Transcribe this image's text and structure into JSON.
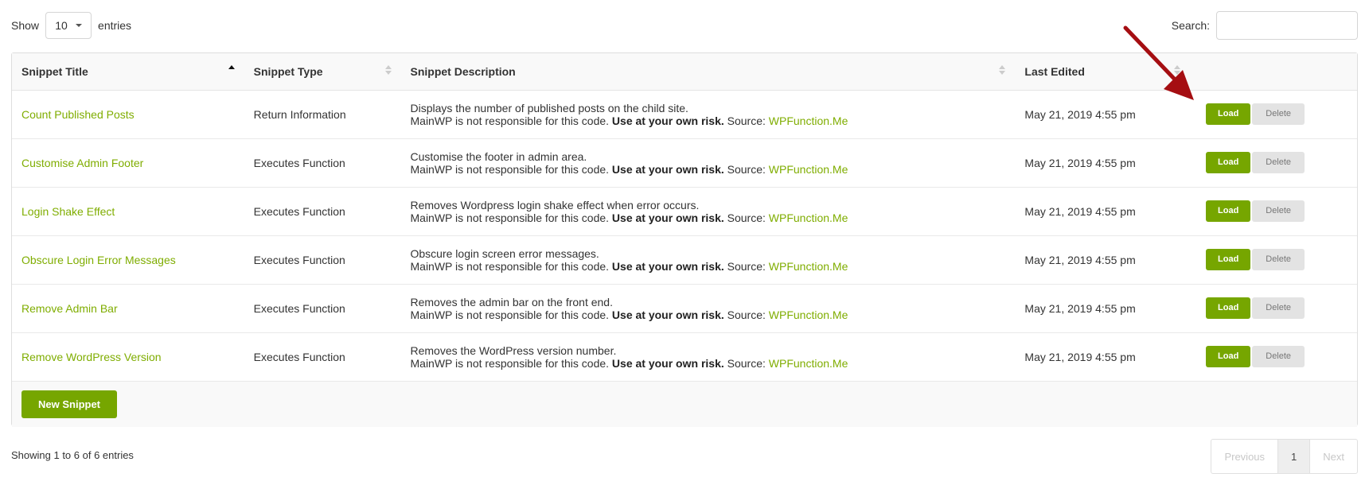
{
  "length": {
    "show_label": "Show",
    "value": "10",
    "entries_label": "entries"
  },
  "search": {
    "label": "Search:",
    "value": "",
    "placeholder": ""
  },
  "table": {
    "columns": [
      "Snippet Title",
      "Snippet Type",
      "Snippet Description",
      "Last Edited"
    ],
    "rows": [
      {
        "title": "Count Published Posts",
        "type": "Return Information",
        "desc": "Displays the number of published posts on the child site.",
        "edited": "May 21, 2019 4:55 pm"
      },
      {
        "title": "Customise Admin Footer",
        "type": "Executes Function",
        "desc": "Customise the footer in admin area.",
        "edited": "May 21, 2019 4:55 pm"
      },
      {
        "title": "Login Shake Effect",
        "type": "Executes Function",
        "desc": "Removes Wordpress login shake effect when error occurs.",
        "edited": "May 21, 2019 4:55 pm"
      },
      {
        "title": "Obscure Login Error Messages",
        "type": "Executes Function",
        "desc": "Obscure login screen error messages.",
        "edited": "May 21, 2019 4:55 pm"
      },
      {
        "title": "Remove Admin Bar",
        "type": "Executes Function",
        "desc": "Removes the admin bar on the front end.",
        "edited": "May 21, 2019 4:55 pm"
      },
      {
        "title": "Remove WordPress Version",
        "type": "Executes Function",
        "desc": "Removes the WordPress version number.",
        "edited": "May 21, 2019 4:55 pm"
      }
    ],
    "disclaimer_prefix": "MainWP is not responsible for this code.",
    "disclaimer_bold": "Use at your own risk.",
    "source_label": "Source:",
    "source_link": "WPFunction.Me",
    "load_label": "Load",
    "delete_label": "Delete"
  },
  "new_snippet_label": "New Snippet",
  "info": "Showing 1 to 6 of 6 entries",
  "pager": {
    "previous": "Previous",
    "current": "1",
    "next": "Next"
  },
  "colors": {
    "accent": "#76a600",
    "link": "#7fad00",
    "annotation_arrow": "#a50e12"
  }
}
